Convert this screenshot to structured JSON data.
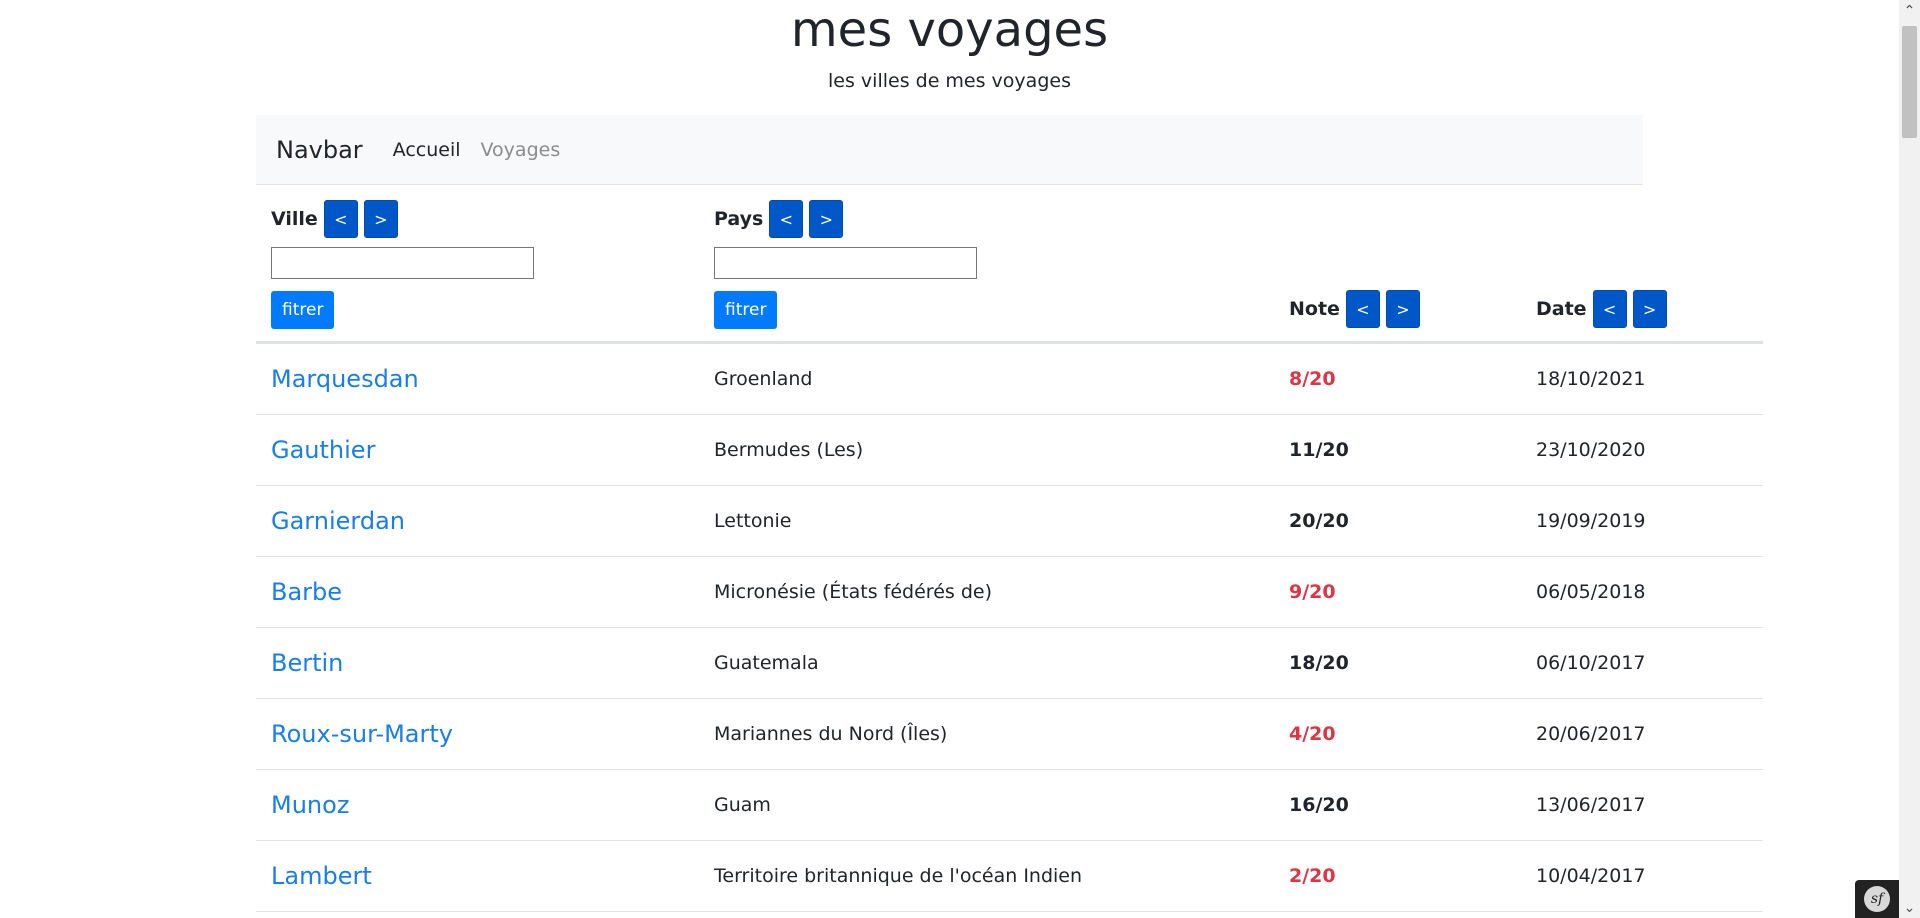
{
  "header": {
    "title": "mes voyages",
    "subtitle": "les villes de mes voyages"
  },
  "navbar": {
    "brand": "Navbar",
    "links": [
      {
        "label": "Accueil",
        "active": true
      },
      {
        "label": "Voyages",
        "active": false
      }
    ]
  },
  "table": {
    "columns": {
      "ville": {
        "label": "Ville",
        "prev": "<",
        "next": ">",
        "filter_value": "",
        "filter_button": "fitrer"
      },
      "pays": {
        "label": "Pays",
        "prev": "<",
        "next": ">",
        "filter_value": "",
        "filter_button": "fitrer"
      },
      "note": {
        "label": "Note",
        "prev": "<",
        "next": ">"
      },
      "date": {
        "label": "Date",
        "prev": "<",
        "next": ">"
      }
    },
    "rows": [
      {
        "ville": "Marquesdan",
        "pays": "Groenland",
        "note": "8/20",
        "date": "18/10/2021"
      },
      {
        "ville": "Gauthier",
        "pays": "Bermudes (Les)",
        "note": "11/20",
        "date": "23/10/2020"
      },
      {
        "ville": "Garnierdan",
        "pays": "Lettonie",
        "note": "20/20",
        "date": "19/09/2019"
      },
      {
        "ville": "Barbe",
        "pays": "Micronésie (États fédérés de)",
        "note": "9/20",
        "date": "06/05/2018"
      },
      {
        "ville": "Bertin",
        "pays": "Guatemala",
        "note": "18/20",
        "date": "06/10/2017"
      },
      {
        "ville": "Roux-sur-Marty",
        "pays": "Mariannes du Nord (Îles)",
        "note": "4/20",
        "date": "20/06/2017"
      },
      {
        "ville": "Munoz",
        "pays": "Guam",
        "note": "16/20",
        "date": "13/06/2017"
      },
      {
        "ville": "Lambert",
        "pays": "Territoire britannique de l'océan Indien",
        "note": "2/20",
        "date": "10/04/2017"
      }
    ]
  },
  "colors": {
    "primary_button": "#0057c8",
    "filter_button": "#007bff",
    "link": "#1a7ee8",
    "low_note": "#dc3545"
  },
  "icons": {
    "scroll_up": "chevron-up-icon",
    "scroll_down": "chevron-down-icon",
    "toolbar": "symfony-logo-icon"
  }
}
